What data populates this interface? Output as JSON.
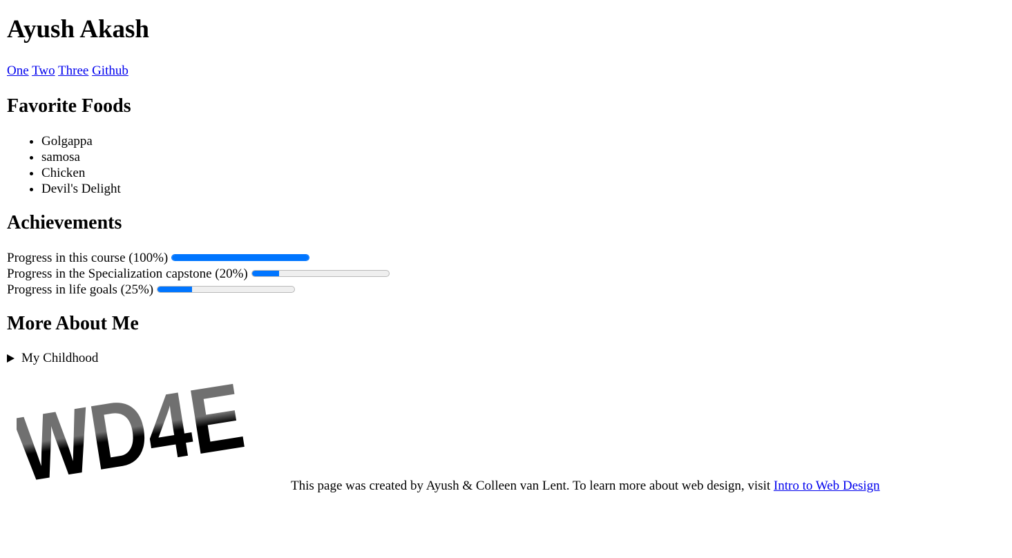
{
  "header": {
    "title": "Ayush Akash"
  },
  "nav": {
    "links": [
      "One",
      "Two",
      "Three",
      "Github"
    ]
  },
  "foods": {
    "heading": "Favorite Foods",
    "items": [
      "Golgappa",
      "samosa",
      "Chicken",
      "Devil's Delight"
    ]
  },
  "achievements": {
    "heading": "Achievements",
    "items": [
      {
        "label": "Progress in this course (100%)",
        "value": 1.0
      },
      {
        "label": "Progress in the Specialization capstone (20%)",
        "value": 0.2
      },
      {
        "label": "Progress in life goals (25%)",
        "value": 0.25
      }
    ]
  },
  "more": {
    "heading": "More About Me",
    "summary": "My Childhood"
  },
  "footer": {
    "logo_text": "WD4E",
    "text": "This page was created by Ayush & Colleen van Lent. To learn more about web design, visit ",
    "link_text": "Intro to Web Design"
  },
  "colors": {
    "link": "#0000ee",
    "progress": "#0075ff"
  }
}
